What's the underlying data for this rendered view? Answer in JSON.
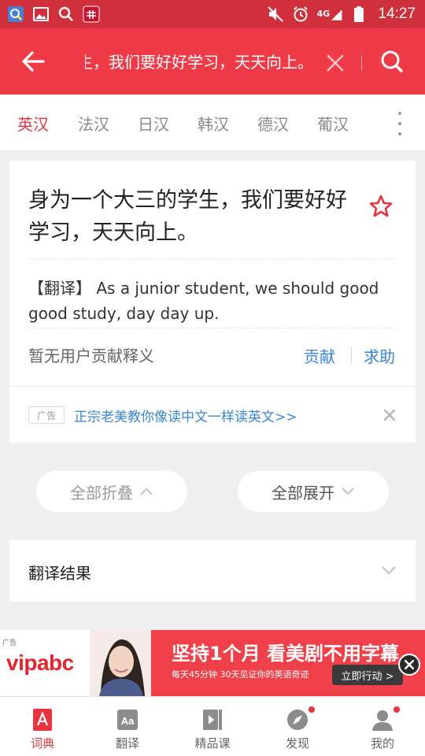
{
  "status_bar": {
    "time": "14:27",
    "network": "4G",
    "left_icons": [
      "map-app-icon",
      "image-icon",
      "search-icon",
      "app-notification-icon"
    ],
    "right_icons": [
      "mute-icon",
      "alarm-icon",
      "signal-icon",
      "battery-icon"
    ]
  },
  "header": {
    "query": "身为一个大三的学生，我们要好好学习，天天向上。",
    "bg_color": "#ef3b47"
  },
  "lang_tabs": [
    {
      "label": "英汉",
      "active": true
    },
    {
      "label": "法汉",
      "active": false
    },
    {
      "label": "日汉",
      "active": false
    },
    {
      "label": "韩汉",
      "active": false
    },
    {
      "label": "德汉",
      "active": false
    },
    {
      "label": "葡汉",
      "active": false
    }
  ],
  "result": {
    "source": "身为一个大三的学生，我们要好好学习，天天向上。",
    "translation": "【翻译】 As a junior student, we should good good study, day day up.",
    "no_user_text": "暂无用户贡献释义",
    "contribute_label": "贡献",
    "help_label": "求助",
    "ad_tag": "广告",
    "ad_text": "正宗老美教你像读中文一样读英文>>"
  },
  "controls": {
    "collapse_all": "全部折叠",
    "expand_all": "全部展开"
  },
  "section": {
    "title": "翻译结果"
  },
  "banner": {
    "ad_label": "广告",
    "brand": "vipabc",
    "headline": "坚持1个月  看美剧不用字幕",
    "subline": "每天45分钟  30天见证你的英语奇迹",
    "cta": "立即行动 >"
  },
  "bottom_nav": [
    {
      "label": "词典",
      "icon": "dictionary-icon",
      "active": true,
      "badge": false
    },
    {
      "label": "翻译",
      "icon": "translate-icon",
      "active": false,
      "badge": false
    },
    {
      "label": "精品课",
      "icon": "course-icon",
      "active": false,
      "badge": false
    },
    {
      "label": "发现",
      "icon": "discover-icon",
      "active": false,
      "badge": true
    },
    {
      "label": "我的",
      "icon": "profile-icon",
      "active": false,
      "badge": true
    }
  ],
  "colors": {
    "accent": "#e8343f",
    "link": "#3a86d6",
    "status_bar": "#d0303b"
  }
}
